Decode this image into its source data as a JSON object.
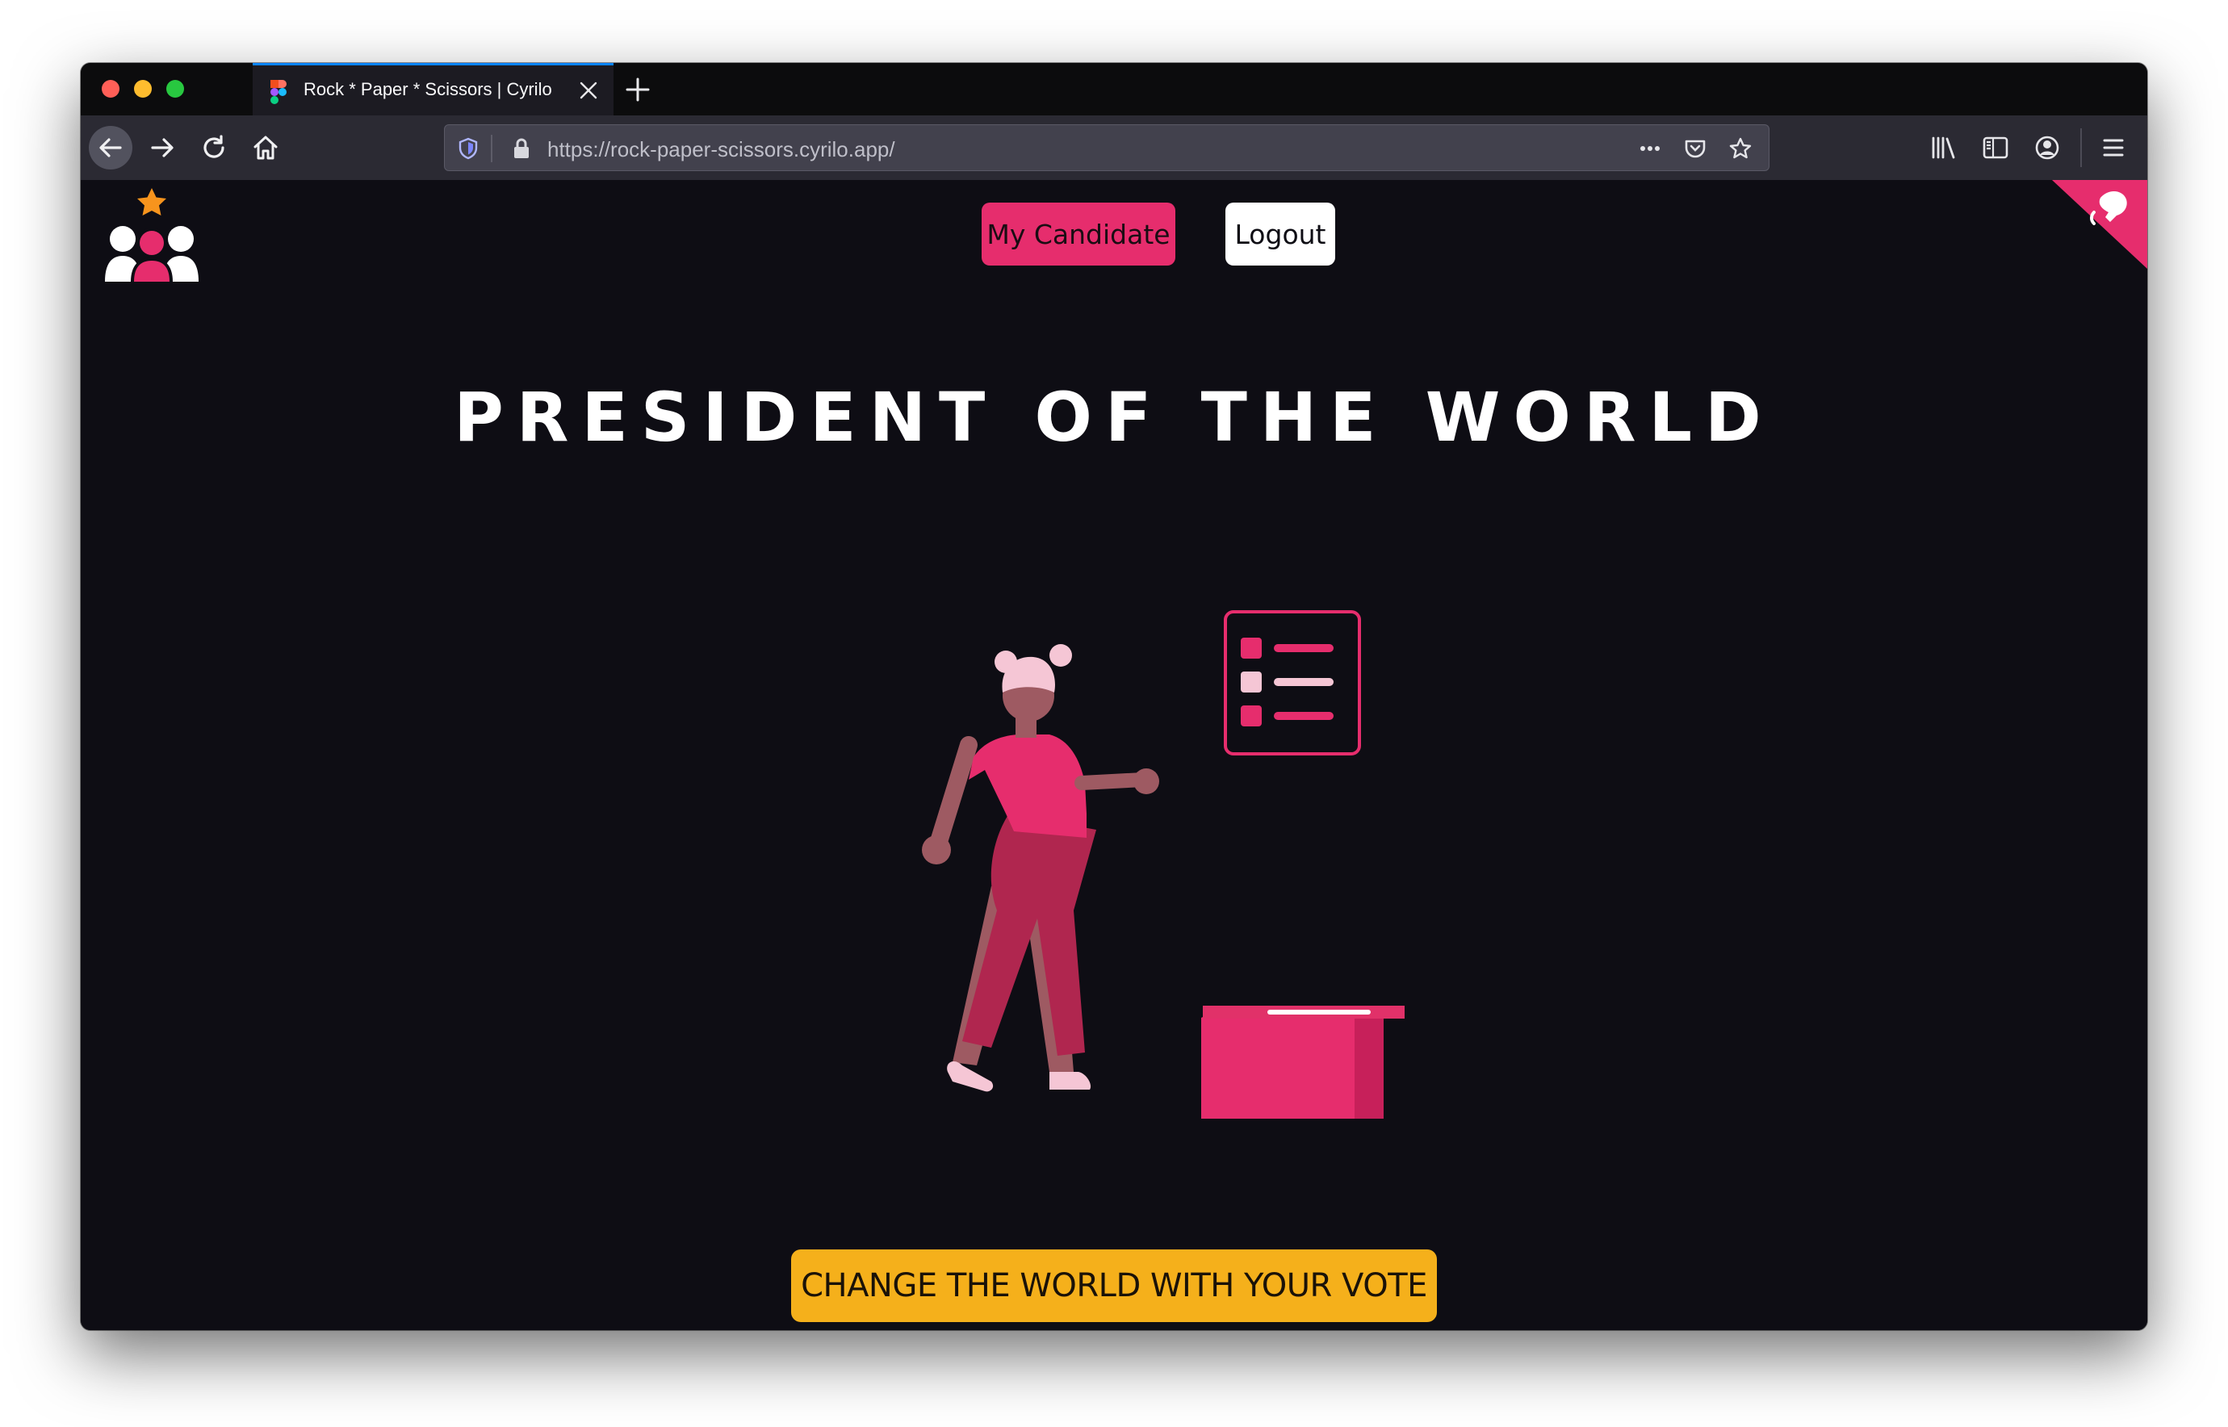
{
  "browser": {
    "tab_title": "Rock * Paper * Scissors | Cyrilo",
    "url": "https://rock-paper-scissors.cyrilo.app/",
    "accent_color": "#0a84ff"
  },
  "header": {
    "my_candidate_label": "My Candidate",
    "logout_label": "Logout"
  },
  "main": {
    "title": "PRESIDENT OF THE WORLD",
    "cta_label": "CHANGE THE WORLD WITH YOUR VOTE"
  },
  "colors": {
    "background": "#0e0d14",
    "primary": "#e62d6d",
    "cta": "#f5b01b",
    "star": "#f7941d"
  },
  "icons": [
    "figma-favicon",
    "close-icon",
    "plus-icon",
    "back-arrow-icon",
    "forward-arrow-icon",
    "reload-icon",
    "home-icon",
    "shield-icon",
    "lock-icon",
    "more-icon",
    "pocket-icon",
    "star-icon",
    "library-icon",
    "sidebar-icon",
    "account-icon",
    "menu-icon",
    "voters-logo-icon",
    "github-corner-icon"
  ]
}
